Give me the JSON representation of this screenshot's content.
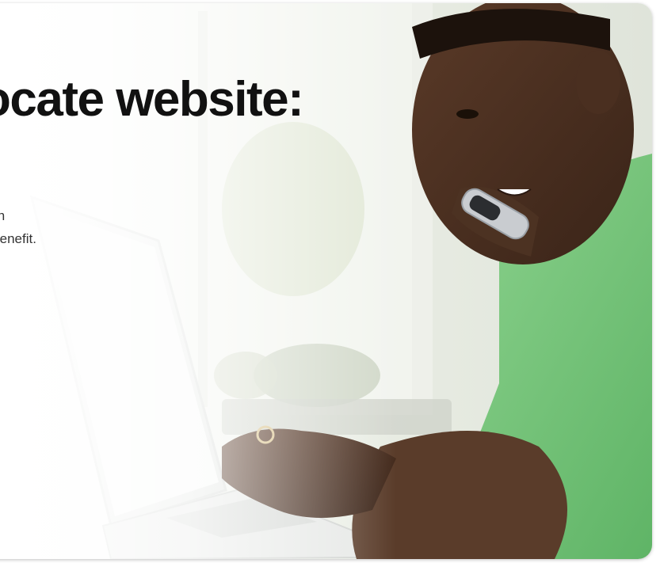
{
  "hero": {
    "headline": "ocate website:",
    "body_lines": [
      "with",
      "e benefit."
    ]
  }
}
